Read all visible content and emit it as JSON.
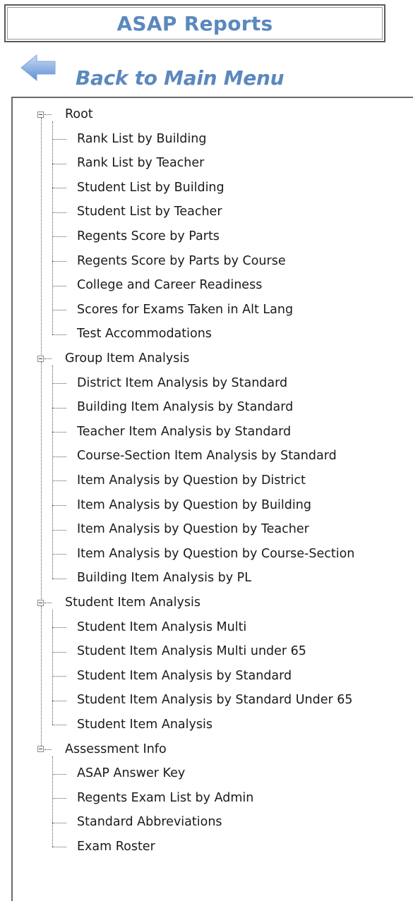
{
  "header": {
    "title": "ASAP Reports"
  },
  "back_link": {
    "label": "Back to Main Menu",
    "icon": "left-arrow-icon"
  },
  "tree": {
    "groups": [
      {
        "label": "Root",
        "expanded": true,
        "items": [
          "Rank List by Building",
          "Rank List by Teacher",
          "Student List by Building",
          "Student List by Teacher",
          "Regents Score by Parts",
          "Regents Score by Parts by Course",
          "College and Career Readiness",
          "Scores for Exams Taken in Alt Lang",
          "Test Accommodations"
        ]
      },
      {
        "label": "Group Item Analysis",
        "expanded": true,
        "items": [
          "District Item Analysis by Standard",
          "Building Item Analysis by Standard",
          "Teacher Item Analysis by Standard",
          "Course-Section Item Analysis by Standard",
          "Item Analysis by Question by District",
          "Item Analysis by Question by Building",
          "Item Analysis by Question by Teacher",
          "Item Analysis by Question by Course-Section",
          "Building Item Analysis by PL"
        ]
      },
      {
        "label": "Student Item Analysis",
        "expanded": true,
        "items": [
          "Student Item Analysis Multi",
          "Student Item Analysis Multi under 65",
          "Student Item Analysis by Standard",
          "Student Item Analysis by Standard Under 65",
          "Student Item Analysis"
        ]
      },
      {
        "label": "Assessment Info",
        "expanded": true,
        "items": [
          "ASAP Answer Key",
          "Regents Exam List by Admin",
          "Standard Abbreviations",
          "Exam Roster"
        ]
      }
    ]
  },
  "colors": {
    "accent": "#5b88be",
    "text": "#1a1a1a",
    "frame": "#5b5b5b"
  }
}
